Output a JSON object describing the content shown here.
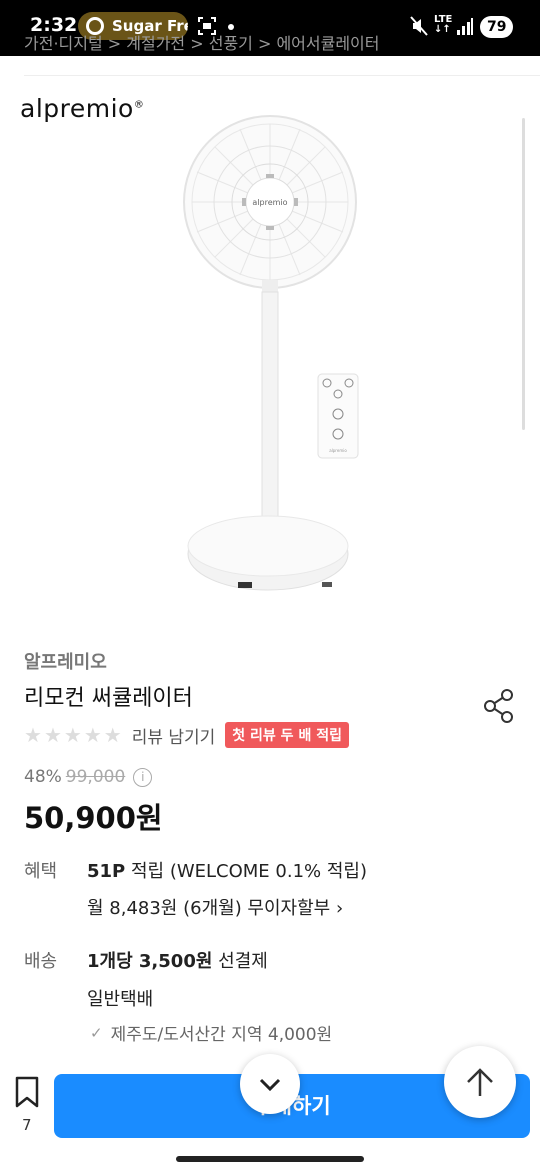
{
  "status_bar": {
    "time": "2:32",
    "notification_label": "Sugar Free",
    "network": "LTE",
    "battery": "79"
  },
  "breadcrumb": "가전·디지털 > 계절가전 > 선풍기 > 에어서큘레이터",
  "product": {
    "image_brand_logo": "alpremio",
    "remote_brand": "alpremio",
    "brand": "알프레미오",
    "title": "리모컨 써큘레이터",
    "rating_stars": 0,
    "review_link": "리뷰 남기기",
    "review_badge": "첫 리뷰 두 배 적립",
    "discount_rate": "48%",
    "original_price": "99,000",
    "price": "50,900원"
  },
  "benefit": {
    "label": "혜택",
    "points": "51P",
    "points_text": " 적립 (WELCOME 0.1% 적립)",
    "installment": "월 8,483원 (6개월) 무이자할부 ›"
  },
  "shipping": {
    "label": "배송",
    "fee_strong": "1개당 3,500원",
    "fee_text": " 선결제",
    "method": "일반택배",
    "extra": "제주도/도서산간 지역 4,000원"
  },
  "bottom": {
    "wishlist_count": "7",
    "buy_label": "구매하기"
  },
  "colors": {
    "accent": "#1a8cff",
    "badge": "#f0595b"
  },
  "icons": [
    "share-icon",
    "info-icon",
    "heart-bookmark-icon",
    "chevron-down-icon",
    "arrow-up-icon",
    "check-icon"
  ]
}
